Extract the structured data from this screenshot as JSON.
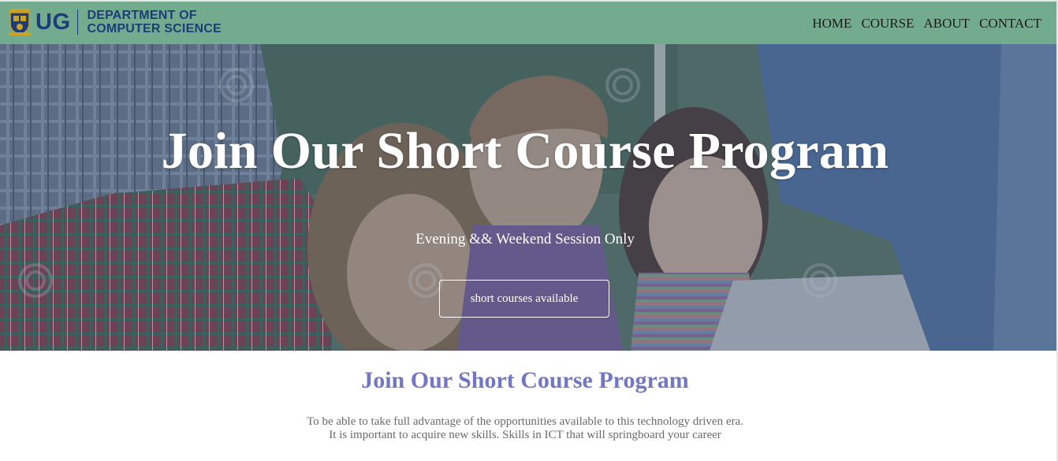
{
  "navbar": {
    "brand_short": "UG",
    "brand_line1": "DEPARTMENT OF",
    "brand_line2": "COMPUTER SCIENCE",
    "links": [
      "HOME",
      "COURSE",
      "ABOUT",
      "CONTACT"
    ]
  },
  "hero": {
    "title": "Join Our Short Course Program",
    "subtitle": "Evening && Weekend Session Only",
    "button_label": "short courses available"
  },
  "section": {
    "title": "Join Our Short Course Program",
    "text_line1": "To be able to take full advantage of the opportunities available to this technology driven era.",
    "text_line2": "It is important to acquire new skills. Skills in ICT that will springboard your career"
  },
  "colors": {
    "navbar_bg": "#72ab8d",
    "brand_blue": "#1d3d7a",
    "section_title": "#7276c4",
    "body_text": "#6a6a6a"
  }
}
